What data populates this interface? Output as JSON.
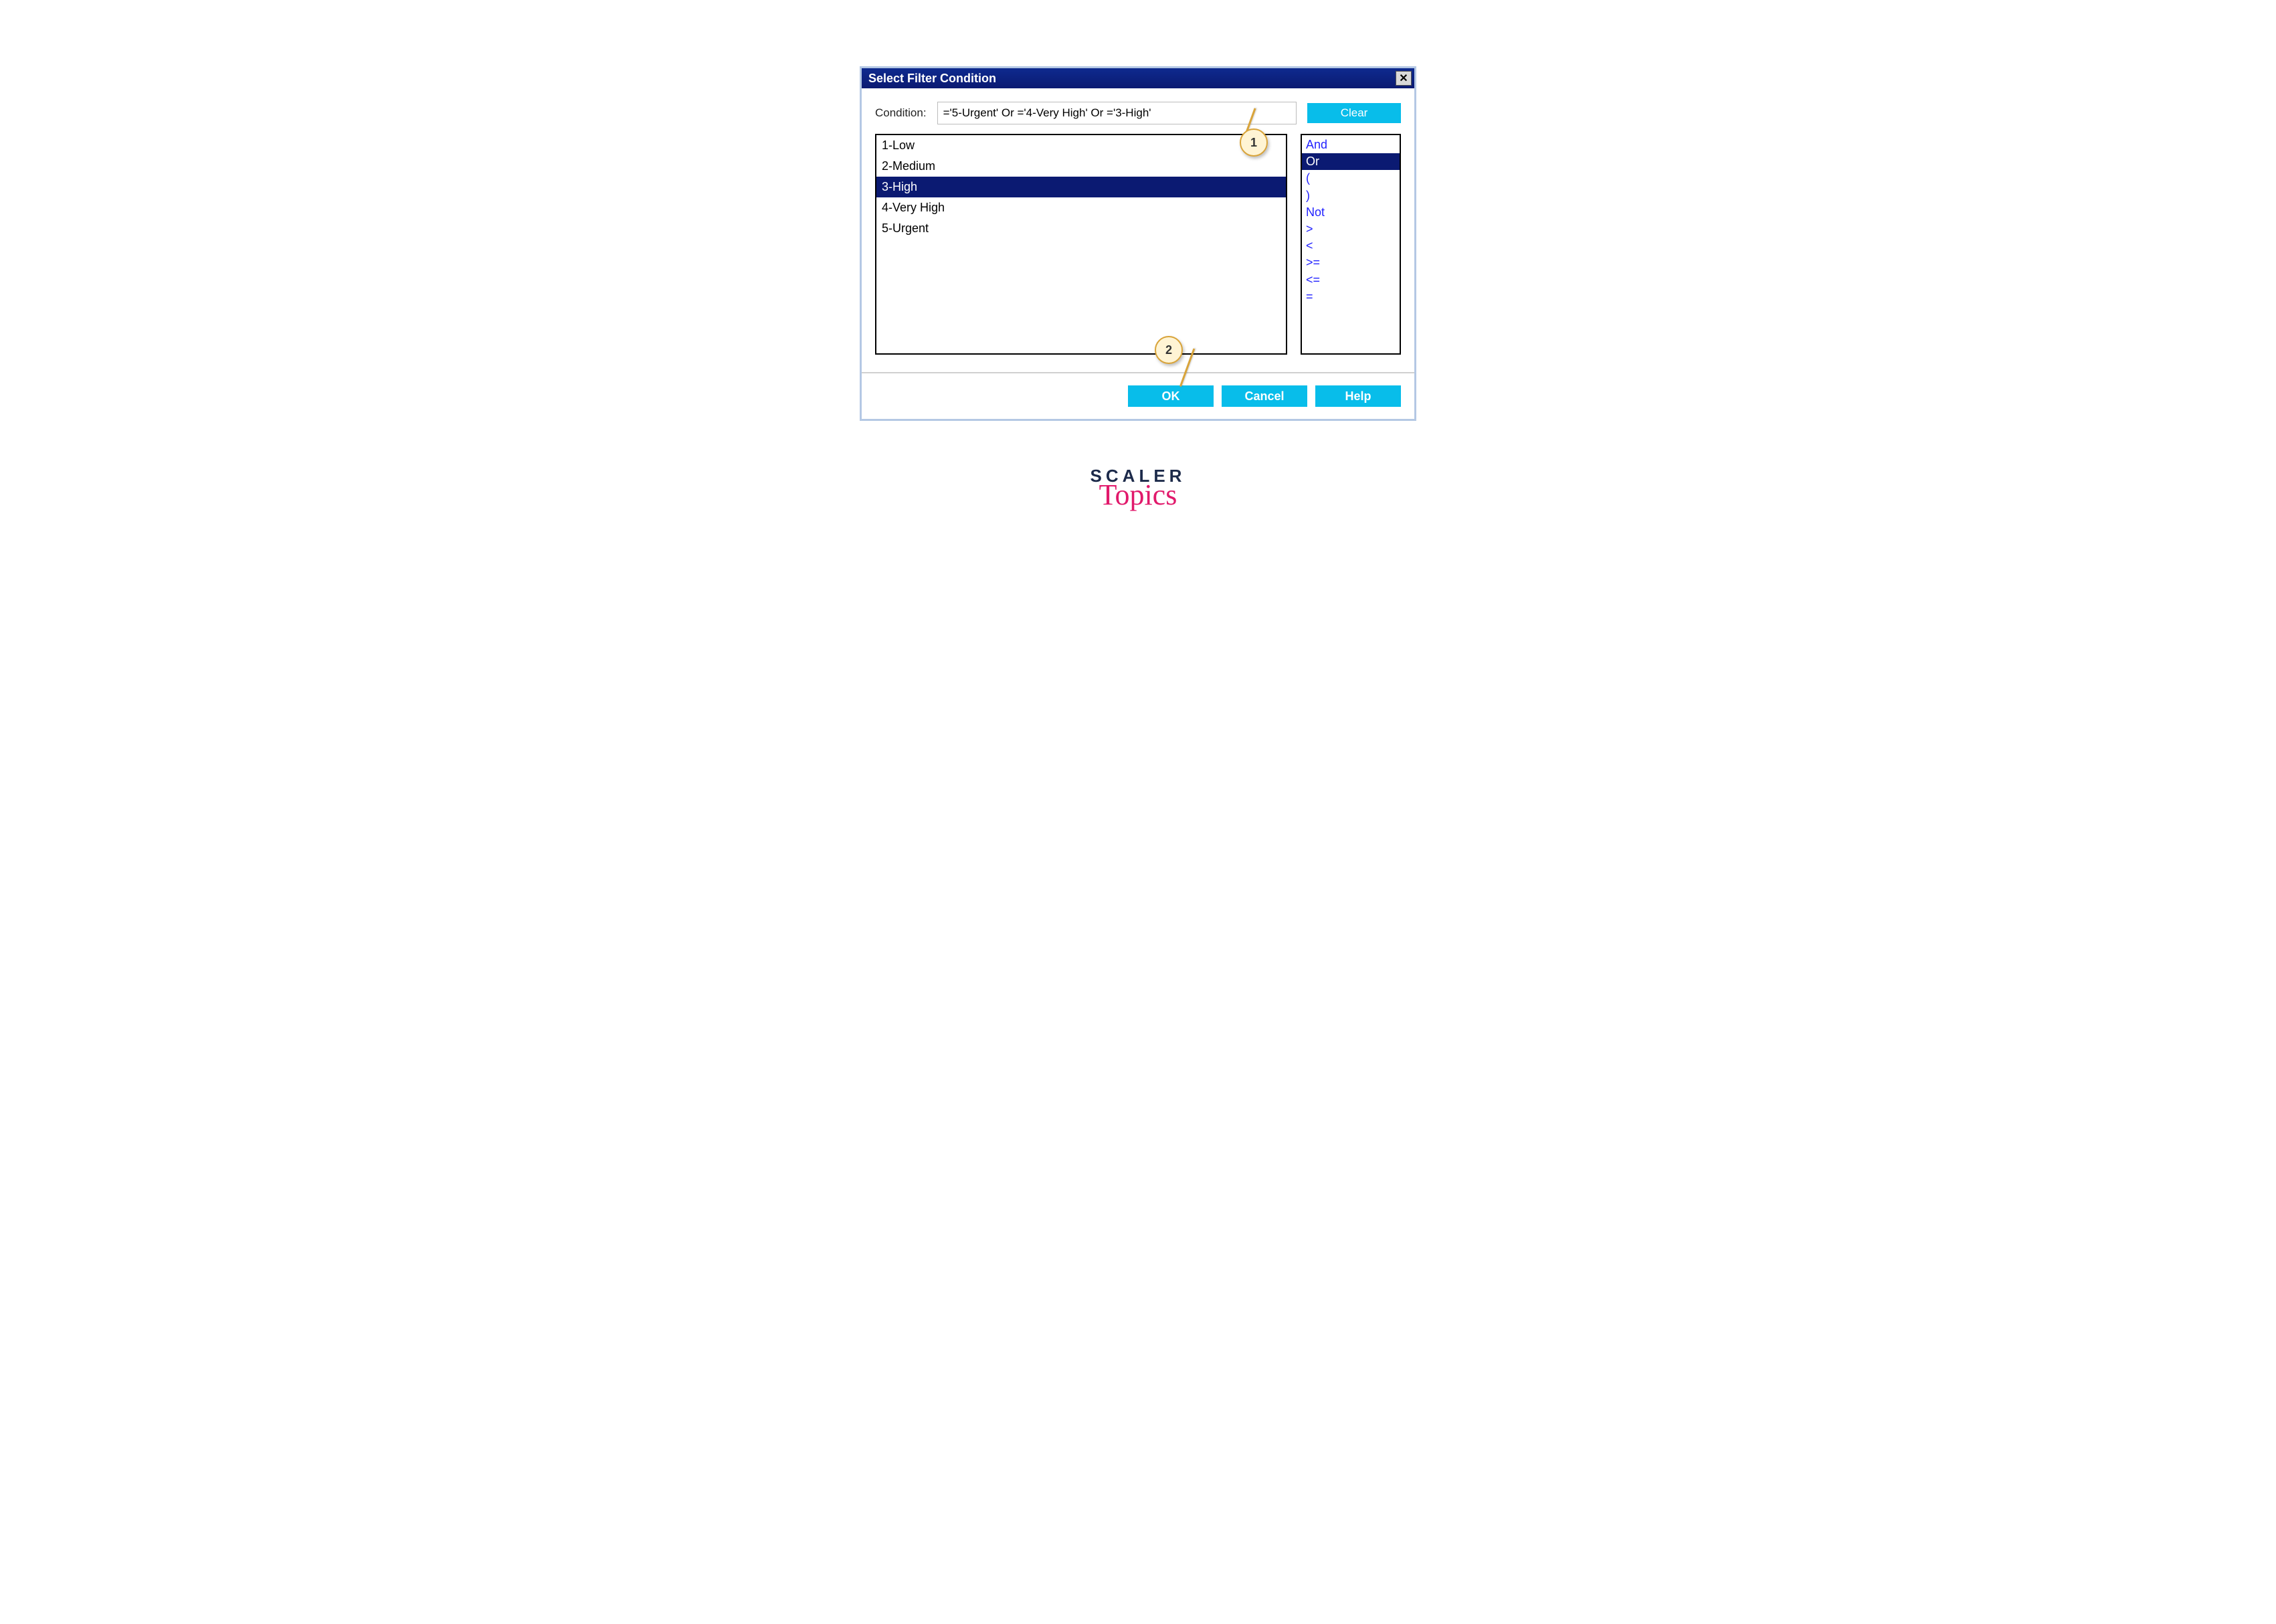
{
  "dialog": {
    "title": "Select Filter Condition",
    "close": "✕",
    "condition_label": "Condition:",
    "condition_value": "='5-Urgent' Or ='4-Very High' Or ='3-High'",
    "clear_label": "Clear"
  },
  "values": {
    "items": [
      "1-Low",
      "2-Medium",
      "3-High",
      "4-Very High",
      "5-Urgent"
    ],
    "selected_index": 2
  },
  "operators": {
    "items": [
      "And",
      "Or",
      "(",
      ")",
      "Not",
      ">",
      "<",
      ">=",
      "<=",
      "="
    ],
    "selected_index": 1
  },
  "footer": {
    "ok": "OK",
    "cancel": "Cancel",
    "help": "Help"
  },
  "callouts": {
    "one": "1",
    "two": "2"
  },
  "branding": {
    "line1": "SCALER",
    "line2": "Topics"
  }
}
